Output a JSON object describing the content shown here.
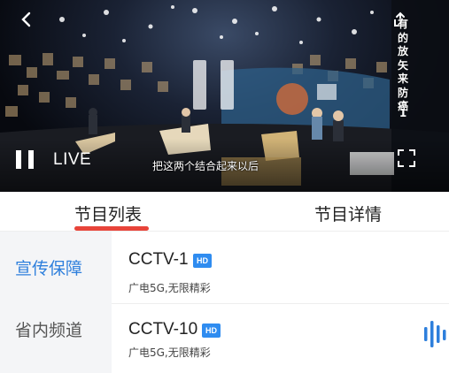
{
  "player": {
    "live_label": "LIVE",
    "subtitle": "把这两个结合起来以后",
    "side_title_chars": [
      "有",
      "的",
      "放",
      "矢",
      "来",
      "防",
      "癌"
    ],
    "side_title_number": "1",
    "state": "paused"
  },
  "tabs": [
    {
      "label": "节目列表",
      "selected": true
    },
    {
      "label": "节目详情",
      "selected": false
    }
  ],
  "sidebar": {
    "items": [
      {
        "label": "宣传保障",
        "selected": true
      },
      {
        "label": "省内频道",
        "selected": false
      }
    ]
  },
  "channels": [
    {
      "name": "CCTV-1",
      "badge": "HD",
      "description": "广电5G,无限精彩",
      "playing": false
    },
    {
      "name": "CCTV-10",
      "badge": "HD",
      "description": "广电5G,无限精彩",
      "playing": true
    }
  ],
  "colors": {
    "accent_blue": "#2e7fdc",
    "tab_indicator": "#e8443a",
    "hd_badge": "#2f8cf0",
    "sidebar_bg": "#f4f5f7"
  },
  "icons": {
    "play_pause": "pause-icon",
    "fullscreen": "fullscreen-icon",
    "back": "back-icon",
    "share": "share-icon",
    "now_playing": "audio-wave-icon"
  }
}
